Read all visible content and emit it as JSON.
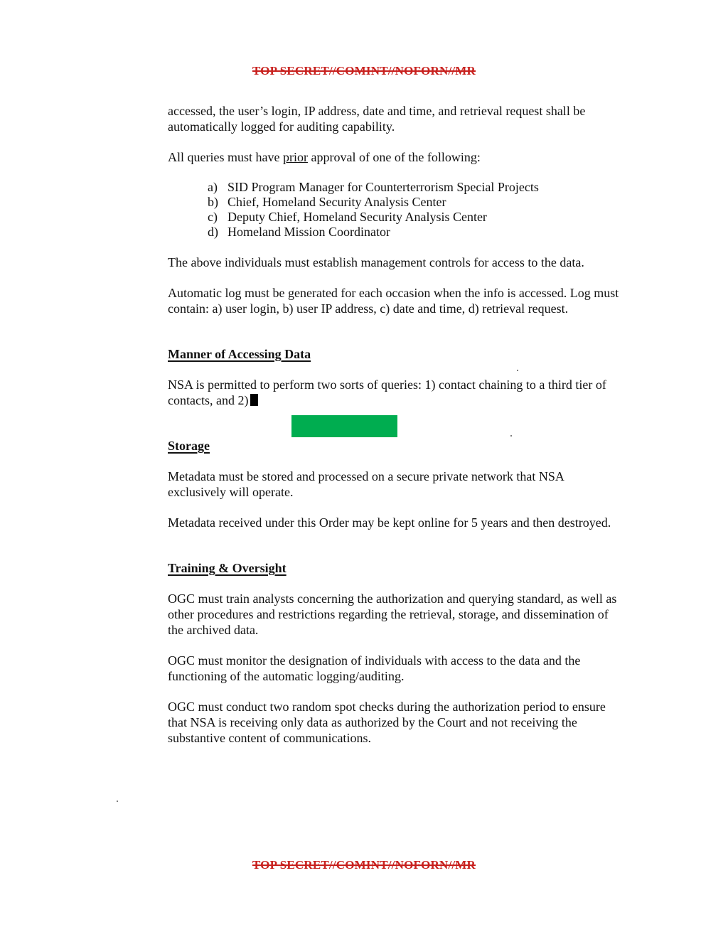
{
  "classification_marking": "TOP SECRET//COMINT//NOFORN//MR",
  "paragraphs": {
    "p1": "accessed, the user’s login, IP address, date and time, and retrieval request shall be automatically logged for auditing capability.",
    "p2_before": "All queries must have ",
    "p2_underlined": "prior",
    "p2_after": " approval of one of the following:",
    "p3": "The above individuals must establish management controls for access to the data.",
    "p4": "Automatic log must be generated for each occasion when the info is accessed. Log must contain: a) user login, b) user IP address, c) date and time, d) retrieval request."
  },
  "approvers": [
    {
      "marker": "a)",
      "text": "SID Program Manager for Counterterrorism Special Projects"
    },
    {
      "marker": "b)",
      "text": "Chief, Homeland Security Analysis Center"
    },
    {
      "marker": "c)",
      "text": "Deputy Chief, Homeland Security Analysis Center"
    },
    {
      "marker": "d)",
      "text": "Homeland Mission Coordinator"
    }
  ],
  "sections": {
    "manner": {
      "heading": "Manner of Accessing Data",
      "text": "NSA is permitted to perform two sorts of queries:  1) contact chaining to a third tier of contacts, and 2)"
    },
    "storage": {
      "heading": "Storage",
      "p1": "Metadata must be stored and processed on a secure private network that NSA exclusively will operate.",
      "p2": "Metadata received under this Order may be kept online for 5 years and then destroyed."
    },
    "training": {
      "heading": "Training & Oversight",
      "p1": "OGC must train analysts concerning the authorization and querying standard, as well as other procedures and restrictions regarding the retrieval, storage, and dissemination of the archived data.",
      "p2": "OGC must monitor the designation of individuals with access to the data and the functioning of the automatic logging/auditing.",
      "p3": "OGC must conduct two random spot checks during the authorization period to ensure that NSA is receiving only data as authorized by the Court and not receiving the substantive content of communications."
    }
  },
  "colors": {
    "classification": "#c8211e",
    "redaction_green": "#00ad50",
    "redaction_black": "#000000"
  }
}
